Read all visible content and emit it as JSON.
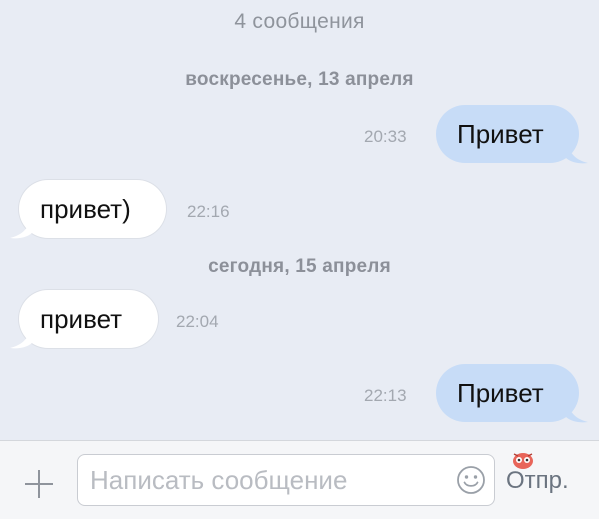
{
  "header": {
    "message_count": "4 сообщения"
  },
  "dates": [
    "воскресенье, 13 апреля",
    "сегодня, 15 апреля"
  ],
  "messages": [
    {
      "direction": "outgoing",
      "text": "Привет",
      "time": "20:33"
    },
    {
      "direction": "incoming",
      "text": "привет)",
      "time": "22:16"
    },
    {
      "direction": "incoming",
      "text": "привет",
      "time": "22:04"
    },
    {
      "direction": "outgoing",
      "text": "Привет",
      "time": "22:13"
    }
  ],
  "composer": {
    "placeholder": "Написать сообщение",
    "value": "",
    "send_label": "Отпр.",
    "attach_icon": "plus-icon",
    "emoji_icon": "smiley-icon"
  },
  "colors": {
    "background": "#e8ecf4",
    "outgoing_bubble": "#c7dcf7",
    "incoming_bubble": "#ffffff",
    "meta_text": "#8f949c"
  }
}
